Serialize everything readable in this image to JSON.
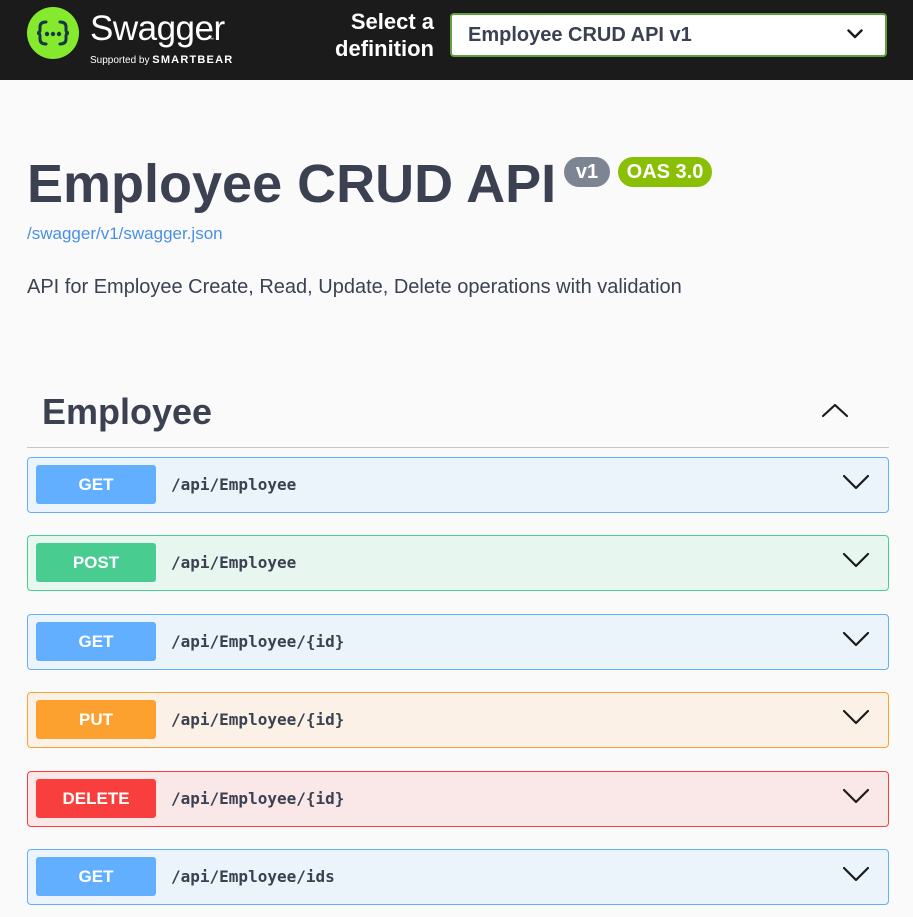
{
  "topbar": {
    "logo_name": "Swagger",
    "logo_tm": "™",
    "logo_supported": "Supported by",
    "logo_vendor": "SMARTBEAR",
    "select_label_line1": "Select a",
    "select_label_line2": "definition",
    "selected_definition": "Employee CRUD API v1",
    "accent": "#62a03f",
    "logo_color": "#85ea2d"
  },
  "info": {
    "title": "Employee CRUD API",
    "version": "v1",
    "oas": "OAS 3.0",
    "spec_url": "/swagger/v1/swagger.json",
    "description": "API for Employee Create, Read, Update, Delete operations with validation"
  },
  "tag": {
    "name": "Employee",
    "icon": "chevron-up-icon"
  },
  "operations": [
    {
      "method": "GET",
      "path": "/api/Employee",
      "color": "#61affe"
    },
    {
      "method": "POST",
      "path": "/api/Employee",
      "color": "#49cc90"
    },
    {
      "method": "GET",
      "path": "/api/Employee/{id}",
      "color": "#61affe"
    },
    {
      "method": "PUT",
      "path": "/api/Employee/{id}",
      "color": "#fca130"
    },
    {
      "method": "DELETE",
      "path": "/api/Employee/{id}",
      "color": "#f93e3e"
    },
    {
      "method": "GET",
      "path": "/api/Employee/ids",
      "color": "#61affe"
    }
  ]
}
